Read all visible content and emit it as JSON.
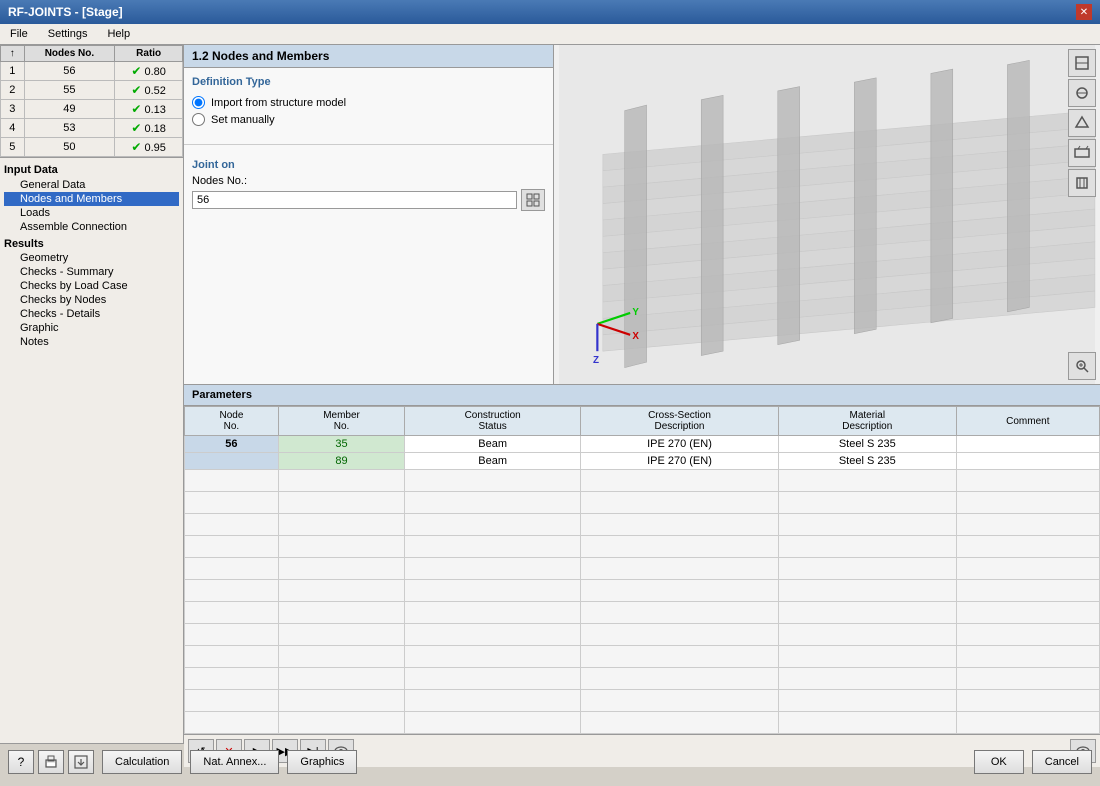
{
  "window": {
    "title": "RF-JOINTS - [Stage]",
    "close_label": "✕"
  },
  "menu": {
    "items": [
      "File",
      "Settings",
      "Help"
    ]
  },
  "left_table": {
    "headers": [
      "↑",
      "Nodes No.",
      "Ratio"
    ],
    "rows": [
      {
        "num": 1,
        "node": 56,
        "ratio": "0.80"
      },
      {
        "num": 2,
        "node": 55,
        "ratio": "0.52"
      },
      {
        "num": 3,
        "node": 49,
        "ratio": "0.13"
      },
      {
        "num": 4,
        "node": 53,
        "ratio": "0.18"
      },
      {
        "num": 5,
        "node": 50,
        "ratio": "0.95"
      }
    ]
  },
  "nav": {
    "input_data_label": "Input Data",
    "items_input": [
      {
        "id": "general-data",
        "label": "General Data",
        "selected": false
      },
      {
        "id": "nodes-members",
        "label": "Nodes and Members",
        "selected": true
      },
      {
        "id": "loads",
        "label": "Loads",
        "selected": false
      },
      {
        "id": "assemble",
        "label": "Assemble Connection",
        "selected": false
      }
    ],
    "results_label": "Results",
    "items_results": [
      {
        "id": "geometry",
        "label": "Geometry",
        "selected": false
      },
      {
        "id": "checks-summary",
        "label": "Checks - Summary",
        "selected": false
      },
      {
        "id": "checks-by-load",
        "label": "Checks by Load Case",
        "selected": false
      },
      {
        "id": "checks-by-nodes",
        "label": "Checks by Nodes",
        "selected": false
      },
      {
        "id": "checks-details",
        "label": "Checks - Details",
        "selected": false
      },
      {
        "id": "graphic",
        "label": "Graphic",
        "selected": false
      },
      {
        "id": "notes",
        "label": "Notes",
        "selected": false
      }
    ]
  },
  "form": {
    "title": "1.2 Nodes and Members",
    "definition_type_label": "Definition Type",
    "radio_options": [
      {
        "id": "import",
        "label": "Import from structure model",
        "checked": true
      },
      {
        "id": "manual",
        "label": "Set manually",
        "checked": false
      }
    ],
    "joint_on_label": "Joint on",
    "nodes_no_label": "Nodes No.:",
    "nodes_no_value": "56",
    "select_btn_label": "..."
  },
  "params": {
    "section_label": "Parameters",
    "columns": [
      "Node No.",
      "Member No.",
      "Construction Status",
      "Cross-Section Description",
      "Material Description",
      "Comment"
    ],
    "rows": [
      {
        "node": "56",
        "member": "35",
        "status": "Beam",
        "cross_section": "IPE 270 (EN)",
        "material": "Steel S 235",
        "comment": ""
      },
      {
        "node": "",
        "member": "89",
        "status": "Beam",
        "cross_section": "IPE 270 (EN)",
        "material": "Steel S 235",
        "comment": ""
      }
    ]
  },
  "bottom_buttons": {
    "calculation": "Calculation",
    "nat_annex": "Nat. Annex...",
    "graphics": "Graphics",
    "ok": "OK",
    "cancel": "Cancel"
  },
  "toolbar_icons": {
    "reset": "↺",
    "delete": "✕",
    "next": "▶",
    "next_all": "▶▶",
    "play": "▶|",
    "eye": "👁"
  }
}
